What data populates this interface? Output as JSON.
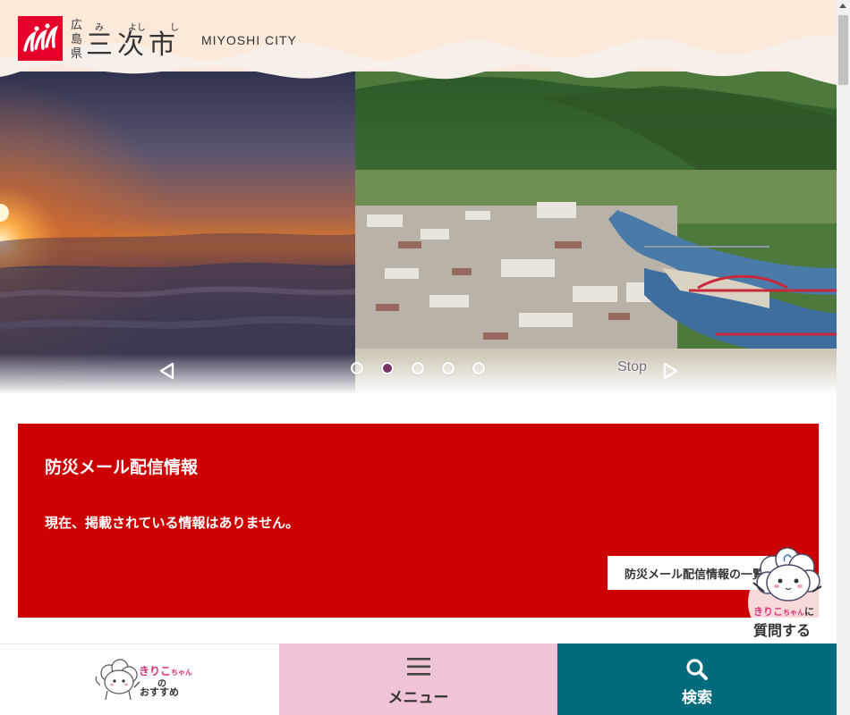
{
  "header": {
    "prefecture": [
      "広",
      "島",
      "県"
    ],
    "city_ruby": [
      "み",
      "よし",
      "し"
    ],
    "city_kanji": [
      "三",
      "次",
      "市"
    ],
    "city_en": "MIYOSHI CITY",
    "logo_icon": "miyoshi-city-logo"
  },
  "slider": {
    "prev_icon": "triangle-left-outline",
    "next_icon": "triangle-right-outline",
    "stop_label": "Stop",
    "slide_count": 5,
    "active_slide": 2
  },
  "alert": {
    "title": "防災メール配信情報",
    "message": "現在、掲載されている情報はありません。",
    "link_label": "防災メール配信情報の一覧へ",
    "bg_color": "#cc0000"
  },
  "chatbot": {
    "name": "きりこ",
    "name_suffix": "ちゃん",
    "particle": "に",
    "action": "質問する"
  },
  "bottom_nav": {
    "recommend": {
      "name": "きりこ",
      "name_suffix": "ちゃん",
      "no": "の",
      "label": "おすすめ"
    },
    "menu": {
      "label": "メニュー",
      "icon": "hamburger-icon",
      "bg_color": "#f1c3d6"
    },
    "search": {
      "label": "検索",
      "icon": "magnifier-icon",
      "bg_color": "#006b7d"
    }
  }
}
